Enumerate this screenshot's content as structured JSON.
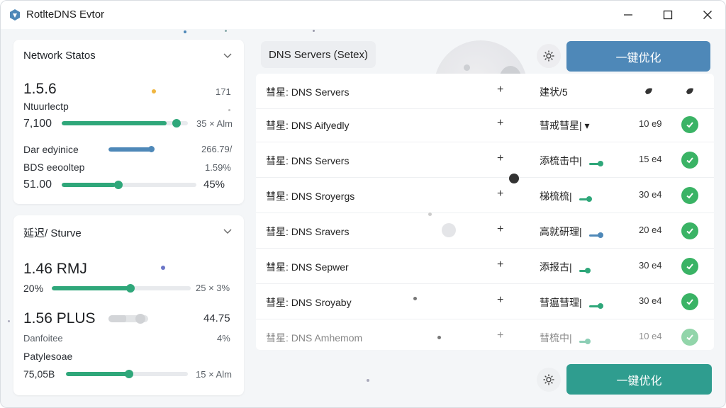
{
  "window": {
    "title": "RotlteDNS Evtor"
  },
  "colors": {
    "green": "#2fa77a",
    "blue": "#4e88b8",
    "teal": "#2f9d8f",
    "check": "#3ab365"
  },
  "network_status": {
    "title": "Network Statos",
    "rows": [
      {
        "label": "1.5.6",
        "right": "171"
      },
      {
        "label": "Ntuurlectp"
      },
      {
        "label": "7,100",
        "right": "35 × Alm",
        "progress": 0.83
      },
      {
        "label": "Dar edyinice",
        "right": "266.79/",
        "progress": 0.5
      },
      {
        "label": "BDS eeooltep",
        "right": "1.59%"
      },
      {
        "label": "51.00",
        "right": "45%",
        "progress": 0.4
      }
    ]
  },
  "latency": {
    "title": "延迟/ Sturve",
    "rows": [
      {
        "label": "1.46 RMJ"
      },
      {
        "label": "20%",
        "right": "25 × 3%",
        "progress": 0.58
      },
      {
        "label": "1.56 PLUS",
        "right": "44.75",
        "progress": 0.45
      },
      {
        "label": "Danfoitee",
        "right": "4%"
      },
      {
        "label": "Patylesoae"
      },
      {
        "label": "75,05B",
        "right": "15 × Alm",
        "progress": 0.51
      }
    ]
  },
  "dns_panel": {
    "tab_label": "DNS Servers (Setex)",
    "optimize_label_top": "一键优化",
    "optimize_label_bottom": "一键优化",
    "header": {
      "name": "彗星: DNS Servers",
      "plus": "+",
      "status": "建状/5"
    },
    "rows": [
      {
        "name": "彗星: DNS Aifyedly",
        "plus": "+",
        "status": "彗戒彗星| ▾",
        "ms": "10 e9"
      },
      {
        "name": "彗星: DNS Servers",
        "plus": "+",
        "status": "添梳击中|",
        "ms": "15 e4"
      },
      {
        "name": "彗星: DNS Sroyergs",
        "plus": "+",
        "status": "梯梳梳|",
        "ms": "30 e4"
      },
      {
        "name": "彗星: DNS Sravers",
        "plus": "+",
        "status": "高就研理|",
        "ms": "20 e4"
      },
      {
        "name": "彗星: DNS Sepwer",
        "plus": "+",
        "status": "添报古|",
        "ms": "30 e4"
      },
      {
        "name": "彗星: DNS Sroyaby",
        "plus": "+",
        "status": "彗瘟彗理|",
        "ms": "30 e4"
      },
      {
        "name": "彗星: DNS Amhemom",
        "plus": "+",
        "status": "彗梳中|",
        "ms": "10 e4"
      }
    ]
  },
  "icons": {
    "logo": "app-logo-icon",
    "min": "minimize-icon",
    "max": "maximize-icon",
    "close": "close-icon",
    "gear": "gear-icon",
    "check": "check-icon"
  }
}
